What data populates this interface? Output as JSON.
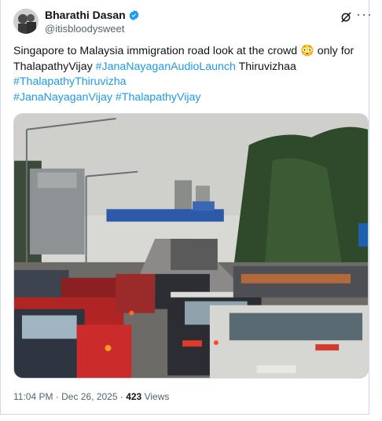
{
  "author": {
    "display_name": "Bharathi Dasan",
    "handle": "@itisbloodysweet"
  },
  "post": {
    "text_part1": "Singapore to Malaysia immigration road look at the crowd ",
    "emoji": "😳",
    "text_part2": " only for",
    "text_part3": "ThalapathyVijay ",
    "hashtag1": "#JanaNayaganAudioLaunch",
    "text_part4": " Thiruvizhaa",
    "hashtag2": "#ThalapathyThiruvizha",
    "hashtag3": "#JanaNayaganVijay",
    "hashtag4": "#ThalapathyVijay"
  },
  "meta": {
    "timestamp": "11:04 PM · Dec 26, 2025",
    "separator": " · ",
    "views_count": "423",
    "views_label": " Views"
  },
  "colors": {
    "link": "#1d9bf0",
    "muted": "#536471",
    "verified": "#1d9bf0"
  },
  "icons": [
    "avatar",
    "verified-badge-icon",
    "grok-icon",
    "more-icon"
  ]
}
